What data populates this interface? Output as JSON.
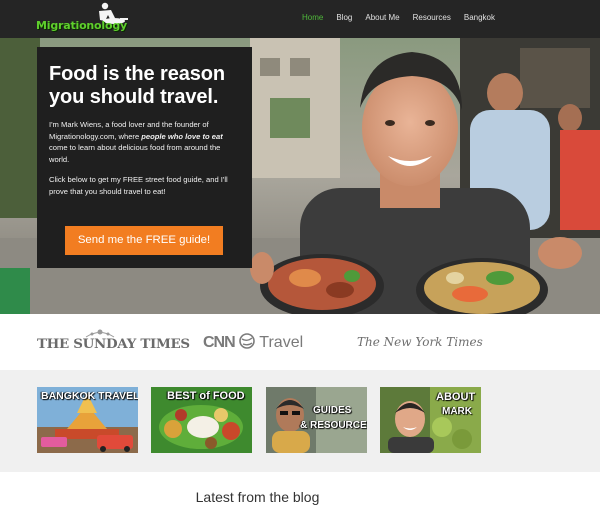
{
  "nav": {
    "logo_text": "Migrationology",
    "items": [
      {
        "label": "Home",
        "active": true
      },
      {
        "label": "Blog",
        "active": false
      },
      {
        "label": "About Me",
        "active": false
      },
      {
        "label": "Resources",
        "active": false
      },
      {
        "label": "Bangkok",
        "active": false
      }
    ]
  },
  "hero": {
    "title_line1": "Food is the reason",
    "title_line2": "you should travel.",
    "intro_before": "I'm Mark Wiens, a food lover and the founder of Migrationology.com, where ",
    "intro_emphasis": "people who love to eat",
    "intro_after": " come to learn about delicious food from around the world.",
    "paragraph2": "Click below to get my FREE street food guide, and I'll prove that you should travel to eat!",
    "cta_label": "Send me the FREE guide!"
  },
  "press": {
    "sunday_times": "THE SUNDAY TIMES",
    "cnn_logo": "CNN",
    "cnn_travel": "Travel",
    "nyt": "The New York Times"
  },
  "tiles": [
    {
      "line1": "BANGKOK TRAVEL",
      "line2": ""
    },
    {
      "line1": "BEST of FOOD",
      "line2": ""
    },
    {
      "line1": "GUIDES",
      "line2": "& RESOURCES"
    },
    {
      "line1": "ABOUT",
      "line2": "MARK"
    }
  ],
  "latest_heading": "Latest from the blog",
  "colors": {
    "nav_bg": "#252525",
    "nav_active": "#4fb83a",
    "hero_box": "#1f1f1f",
    "cta": "#f27d21",
    "tiles_bg": "#f0f0f0"
  }
}
